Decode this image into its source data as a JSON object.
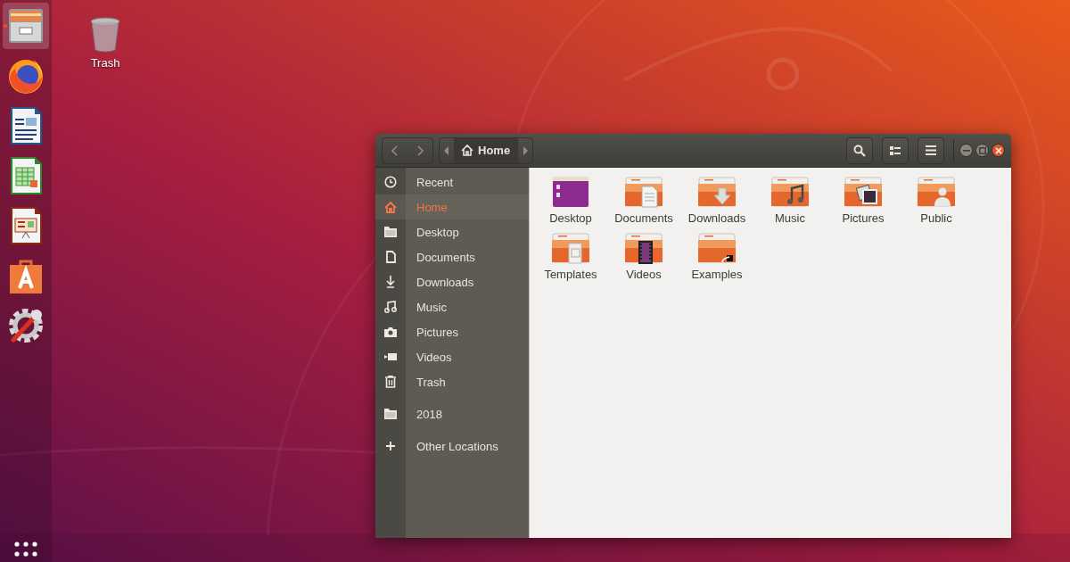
{
  "dock": {
    "apps": [
      {
        "kind": "files",
        "selected": true,
        "running": true
      },
      {
        "kind": "browser",
        "selected": false,
        "running": false
      },
      {
        "kind": "writer",
        "selected": false,
        "running": false
      },
      {
        "kind": "calc",
        "selected": false,
        "running": false
      },
      {
        "kind": "impress",
        "selected": false,
        "running": false
      },
      {
        "kind": "software",
        "selected": false,
        "running": false
      },
      {
        "kind": "settings",
        "selected": false,
        "running": false
      }
    ]
  },
  "desktop_icons": [
    {
      "label": "Trash",
      "kind": "trash"
    }
  ],
  "window": {
    "path": {
      "label": "Home"
    },
    "sidebar": {
      "sections": [
        [
          {
            "label": "Recent",
            "kind": "recent",
            "selected": false
          },
          {
            "label": "Home",
            "kind": "home",
            "selected": true
          },
          {
            "label": "Desktop",
            "kind": "folder",
            "selected": false
          },
          {
            "label": "Documents",
            "kind": "document",
            "selected": false
          },
          {
            "label": "Downloads",
            "kind": "download",
            "selected": false
          },
          {
            "label": "Music",
            "kind": "music",
            "selected": false
          },
          {
            "label": "Pictures",
            "kind": "camera",
            "selected": false
          },
          {
            "label": "Videos",
            "kind": "video",
            "selected": false
          },
          {
            "label": "Trash",
            "kind": "trash",
            "selected": false
          }
        ],
        [
          {
            "label": "2018",
            "kind": "folder",
            "selected": false
          }
        ],
        [
          {
            "label": "Other Locations",
            "kind": "plus",
            "selected": false
          }
        ]
      ]
    },
    "files": [
      {
        "label": "Desktop",
        "kind": "desktop"
      },
      {
        "label": "Documents",
        "kind": "documents"
      },
      {
        "label": "Downloads",
        "kind": "downloads"
      },
      {
        "label": "Music",
        "kind": "music"
      },
      {
        "label": "Pictures",
        "kind": "pictures"
      },
      {
        "label": "Public",
        "kind": "public"
      },
      {
        "label": "Templates",
        "kind": "templates"
      },
      {
        "label": "Videos",
        "kind": "videos"
      },
      {
        "label": "Examples",
        "kind": "examples"
      }
    ]
  }
}
